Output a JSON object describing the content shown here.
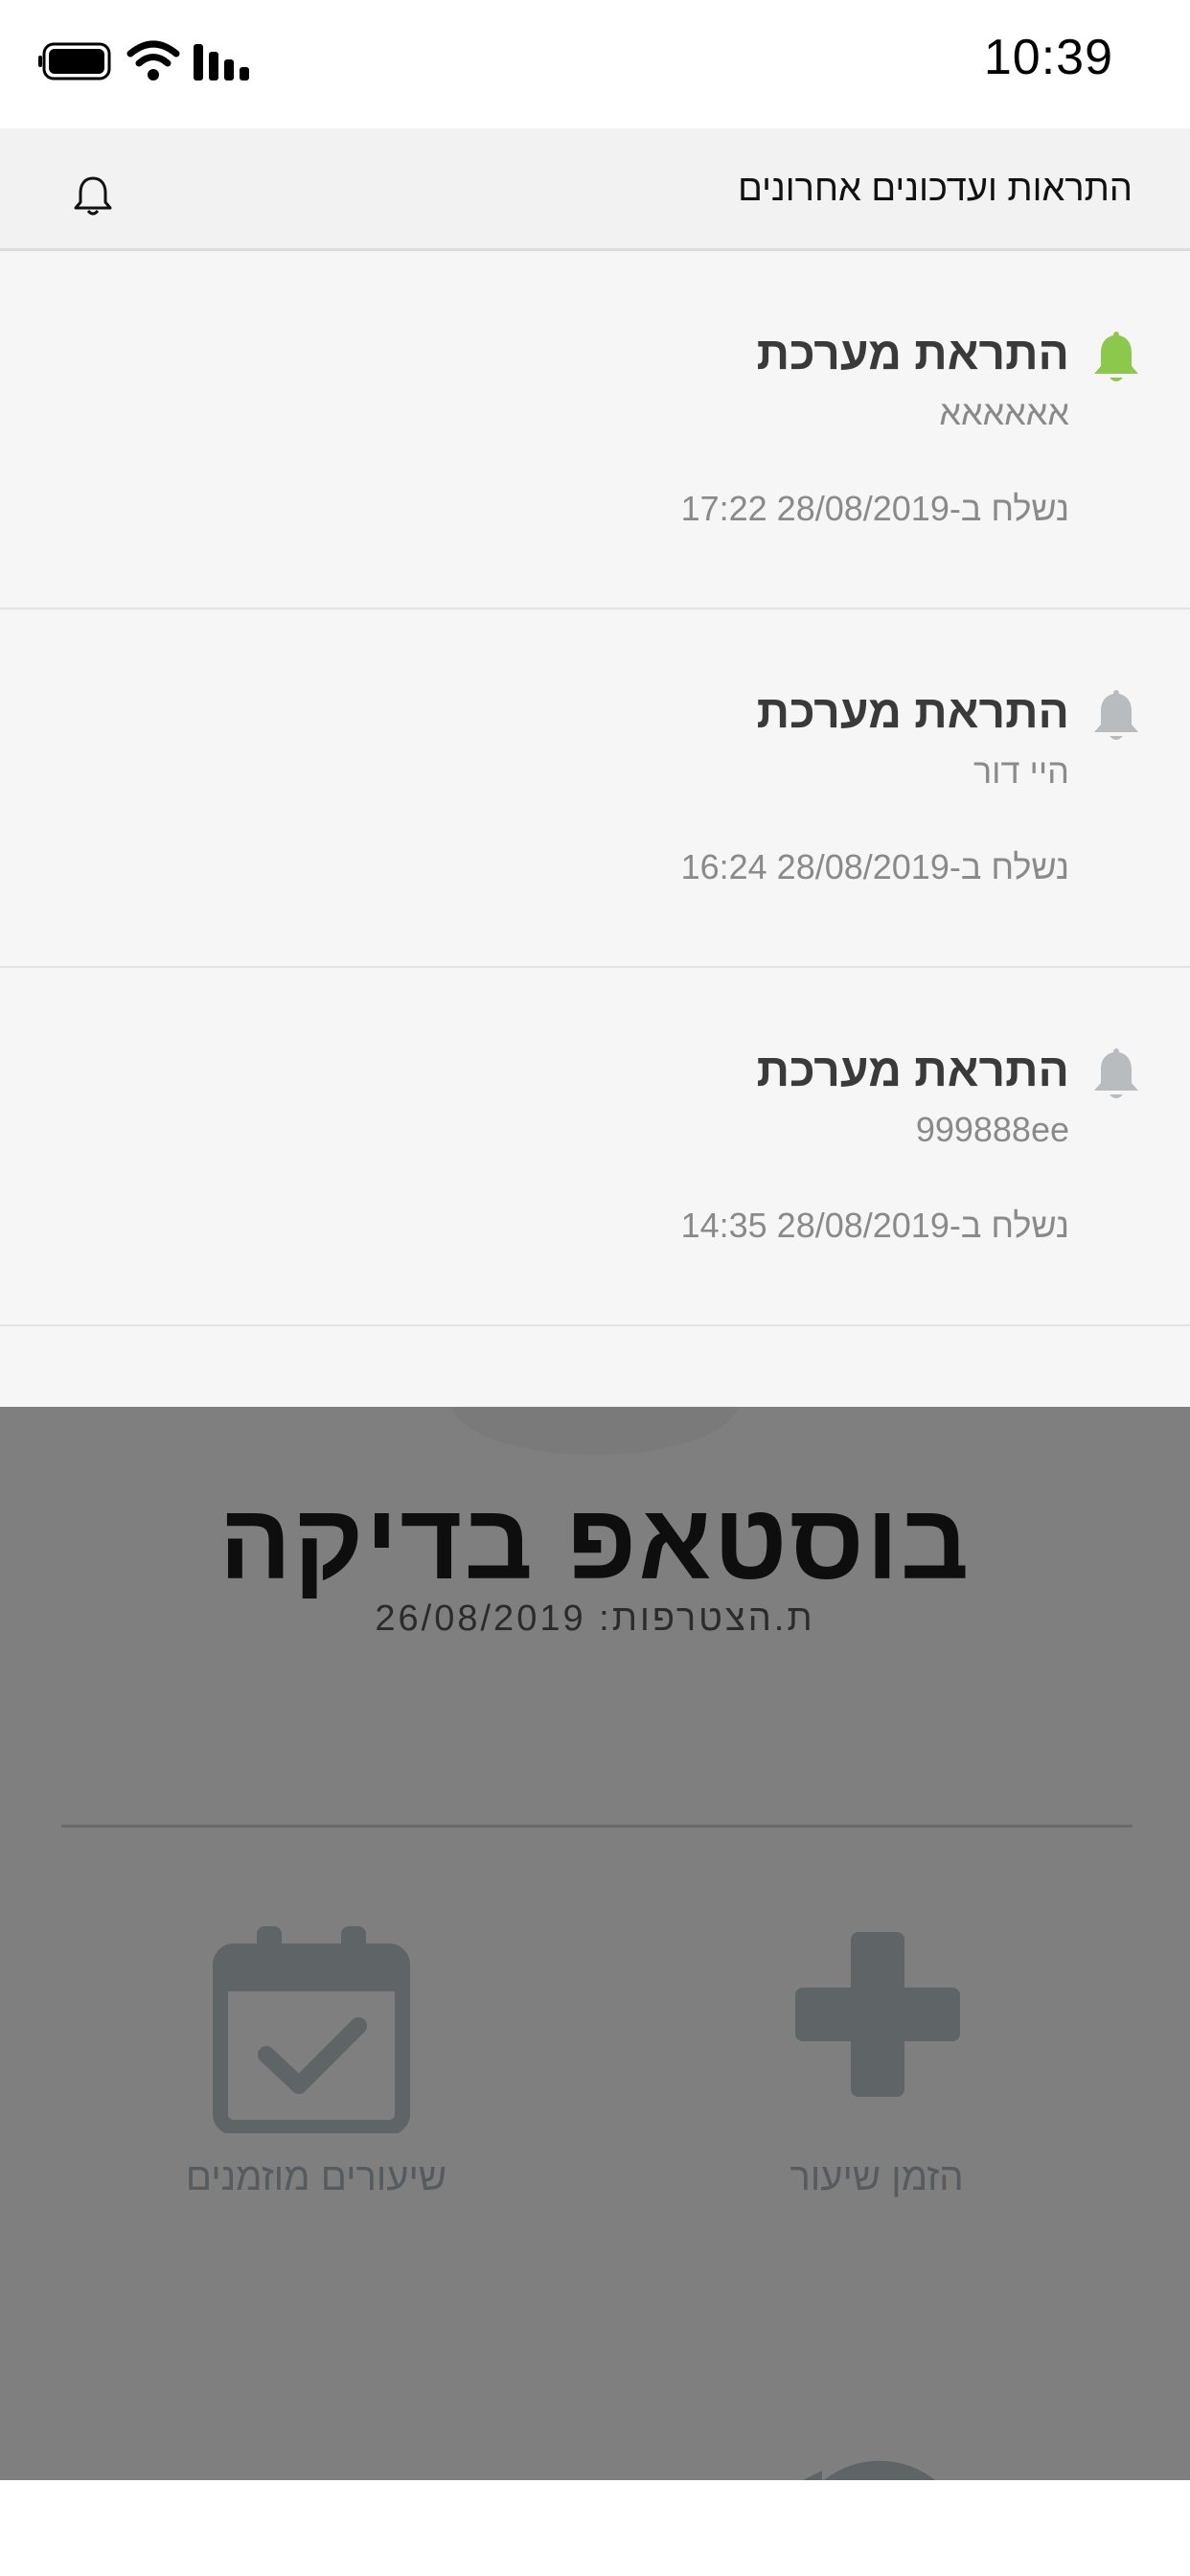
{
  "status_bar": {
    "time": "10:39"
  },
  "notifications": {
    "header_title": "התראות ועדכונים אחרונים",
    "items": [
      {
        "title": "התראת מערכת",
        "body": "אאאאאא",
        "sent": "נשלח ב-28/08/2019 17:22",
        "bell_color": "#8cc84b"
      },
      {
        "title": "התראת מערכת",
        "body": "היי דור",
        "sent": "נשלח ב-28/08/2019 16:24",
        "bell_color": "#b8bcbf"
      },
      {
        "title": "התראת מערכת",
        "body": "999888ee",
        "sent": "נשלח ב-28/08/2019 14:35",
        "bell_color": "#b8bcbf"
      }
    ]
  },
  "profile": {
    "name": "בוסטאפ בדיקה",
    "join_date": "ת.הצטרפות: 26/08/2019",
    "actions": [
      {
        "label": "הזמן שיעור",
        "icon": "plus-icon"
      },
      {
        "label": "שיעורים מוזמנים",
        "icon": "calendar-check-icon"
      }
    ]
  },
  "colors": {
    "overlay": "#7f7f7f",
    "icon_gray": "#5f6467",
    "accent_green": "#8cc84b"
  }
}
